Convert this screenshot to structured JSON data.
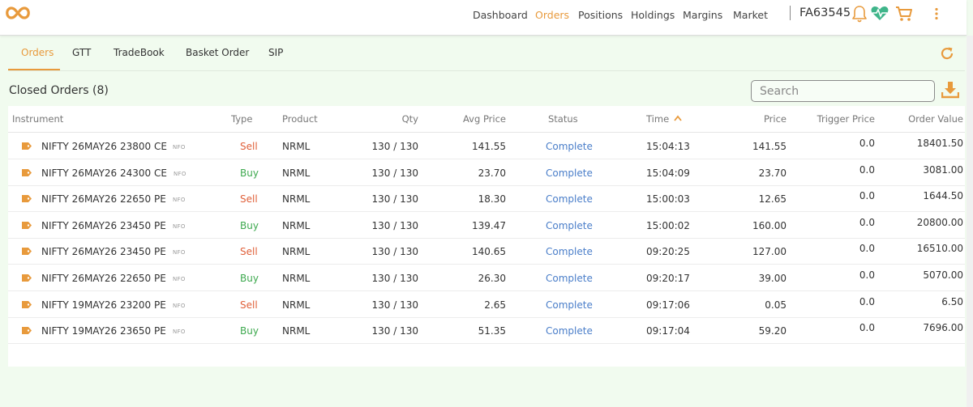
{
  "colors": {
    "accent": "#e89a3c",
    "sell": "#e0603a",
    "buy": "#3ea94f",
    "status": "#4a7ec9",
    "heart": "#3fb58a"
  },
  "nav": {
    "items": [
      {
        "label": "Dashboard",
        "active": false
      },
      {
        "label": "Orders",
        "active": true
      },
      {
        "label": "Positions",
        "active": false
      },
      {
        "label": "Holdings",
        "active": false
      },
      {
        "label": "Margins",
        "active": false
      },
      {
        "label": "Market",
        "active": false
      }
    ],
    "user_id": "FA63545",
    "icons": [
      "bell-icon",
      "heartbeat-icon",
      "cart-icon",
      "kebab-menu-icon"
    ]
  },
  "subtabs": [
    {
      "label": "Orders",
      "active": true
    },
    {
      "label": "GTT"
    },
    {
      "label": "TradeBook"
    },
    {
      "label": "Basket Order"
    },
    {
      "label": "SIP"
    }
  ],
  "section": {
    "title": "Closed Orders (8)"
  },
  "search": {
    "placeholder": "Search"
  },
  "table": {
    "columns": [
      "Instrument",
      "Type",
      "Product",
      "Qty",
      "Avg Price",
      "Status",
      "Time",
      "Price",
      "Trigger Price",
      "Order Value"
    ],
    "sort": {
      "column": "Time",
      "direction": "asc"
    },
    "rows": [
      {
        "instrument": "NIFTY 26MAY26 23800 CE",
        "exchange": "NFO",
        "type": "Sell",
        "product": "NRML",
        "qty": "130 / 130",
        "avg_price": "141.55",
        "status": "Complete",
        "time": "15:04:13",
        "price": "141.55",
        "trigger_price": "0.0",
        "order_value": "18401.50"
      },
      {
        "instrument": "NIFTY 26MAY26 24300 CE",
        "exchange": "NFO",
        "type": "Buy",
        "product": "NRML",
        "qty": "130 / 130",
        "avg_price": "23.70",
        "status": "Complete",
        "time": "15:04:09",
        "price": "23.70",
        "trigger_price": "0.0",
        "order_value": "3081.00"
      },
      {
        "instrument": "NIFTY 26MAY26 22650 PE",
        "exchange": "NFO",
        "type": "Sell",
        "product": "NRML",
        "qty": "130 / 130",
        "avg_price": "18.30",
        "status": "Complete",
        "time": "15:00:03",
        "price": "12.65",
        "trigger_price": "0.0",
        "order_value": "1644.50"
      },
      {
        "instrument": "NIFTY 26MAY26 23450 PE",
        "exchange": "NFO",
        "type": "Buy",
        "product": "NRML",
        "qty": "130 / 130",
        "avg_price": "139.47",
        "status": "Complete",
        "time": "15:00:02",
        "price": "160.00",
        "trigger_price": "0.0",
        "order_value": "20800.00"
      },
      {
        "instrument": "NIFTY 26MAY26 23450 PE",
        "exchange": "NFO",
        "type": "Sell",
        "product": "NRML",
        "qty": "130 / 130",
        "avg_price": "140.65",
        "status": "Complete",
        "time": "09:20:25",
        "price": "127.00",
        "trigger_price": "0.0",
        "order_value": "16510.00"
      },
      {
        "instrument": "NIFTY 26MAY26 22650 PE",
        "exchange": "NFO",
        "type": "Buy",
        "product": "NRML",
        "qty": "130 / 130",
        "avg_price": "26.30",
        "status": "Complete",
        "time": "09:20:17",
        "price": "39.00",
        "trigger_price": "0.0",
        "order_value": "5070.00"
      },
      {
        "instrument": "NIFTY 19MAY26 23200 PE",
        "exchange": "NFO",
        "type": "Sell",
        "product": "NRML",
        "qty": "130 / 130",
        "avg_price": "2.65",
        "status": "Complete",
        "time": "09:17:06",
        "price": "0.05",
        "trigger_price": "0.0",
        "order_value": "6.50"
      },
      {
        "instrument": "NIFTY 19MAY26 23650 PE",
        "exchange": "NFO",
        "type": "Buy",
        "product": "NRML",
        "qty": "130 / 130",
        "avg_price": "51.35",
        "status": "Complete",
        "time": "09:17:04",
        "price": "59.20",
        "trigger_price": "0.0",
        "order_value": "7696.00"
      }
    ]
  }
}
